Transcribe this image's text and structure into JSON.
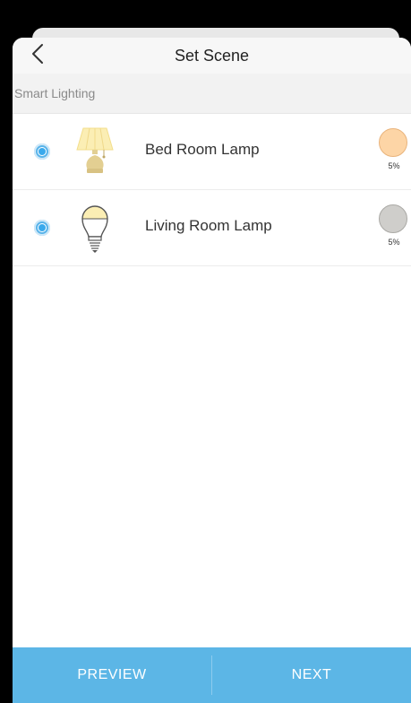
{
  "header": {
    "title": "Set Scene"
  },
  "section": {
    "label": "Smart Lighting"
  },
  "devices": [
    {
      "name": "Bed Room Lamp",
      "icon": "table-lamp-icon",
      "selected": true,
      "swatch_color": "#fdd5a6",
      "brightness": "5%"
    },
    {
      "name": "Living Room Lamp",
      "icon": "light-bulb-icon",
      "selected": true,
      "swatch_color": "#cfcecb",
      "brightness": "5%"
    }
  ],
  "footer": {
    "preview_label": "PREVIEW",
    "next_label": "NEXT"
  },
  "colors": {
    "accent": "#5cb6e6",
    "radio": "#3aa9ec"
  }
}
